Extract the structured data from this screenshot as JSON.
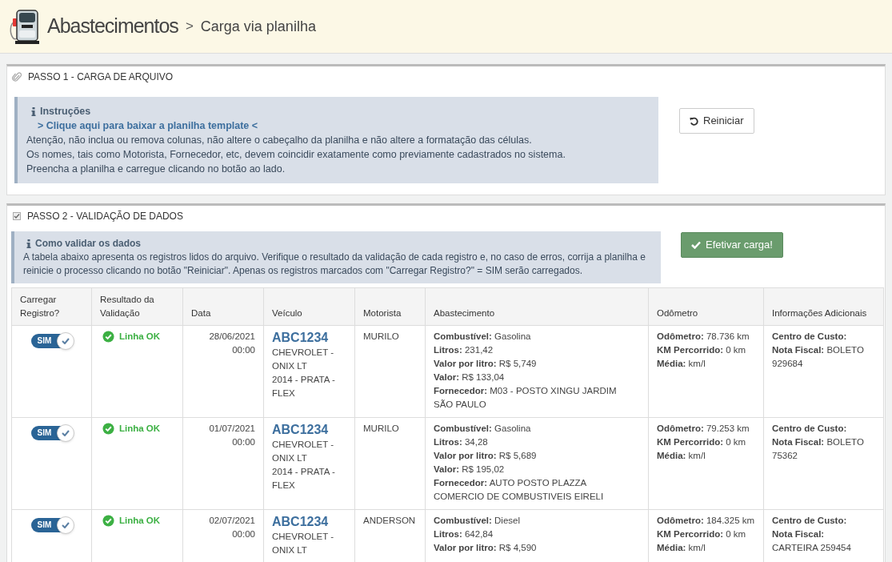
{
  "header": {
    "title": "Abastecimentos",
    "separator": ">",
    "subtitle": "Carga via planilha"
  },
  "step1": {
    "title": "PASSO 1 - CARGA DE ARQUIVO",
    "info_title": "Instruções",
    "download_link": "> Clique aqui para baixar a planilha template <",
    "lines": [
      "Atenção, não inclua ou remova colunas, não altere o cabeçalho da planilha e não altere a formatação das células.",
      "Os nomes, tais como Motorista, Fornecedor, etc, devem coincidir exatamente como previamente cadastrados no sistema.",
      "Preencha a planilha e carregue clicando no botão ao lado."
    ],
    "button": "Reiniciar"
  },
  "step2": {
    "title": "PASSO 2 - VALIDAÇÃO DE DADOS",
    "info_title": "Como validar os dados",
    "text": "A tabela abaixo apresenta os registros lidos do arquivo. Verifique o resultado da validação de cada registro e, no caso de erros, corrija a planilha e reinicie o processo clicando no botão \"Reiniciar\". Apenas os registros marcados com \"Carregar Registro?\" = SIM serão carregados.",
    "button": "Efetivar carga!"
  },
  "table": {
    "columns": [
      "Carregar Registro?",
      "Resultado da Validação",
      "Data",
      "Veículo",
      "Motorista",
      "Abastecimento",
      "Odômetro",
      "Informações Adicionais"
    ],
    "rows": [
      {
        "load": true,
        "toggle_label": "SIM",
        "ok": true,
        "result": "Linha OK",
        "date": "28/06/2021 00:00",
        "plate": "ABC1234",
        "vehicle": "CHEVROLET - ONIX LT",
        "vehicle_details": "2014 - PRATA - FLEX",
        "driver": "MURILO",
        "fueling": [
          "**Combustível:** Gasolina",
          "**Litros:** 231,42",
          "**Valor por litro:**  R$ 5,749",
          "**Valor:**  R$ 133,04",
          "**Fornecedor:** M03 - POSTO XINGU JARDIM SÃO PAULO"
        ],
        "odometer": [
          "**Odômetro:** 78.736 km",
          "**KM Percorrido:** 0 km",
          "**Média:**  km/l"
        ],
        "info": [
          "**Centro de Custo:**",
          "**Nota Fiscal:** BOLETO 929684"
        ]
      },
      {
        "load": true,
        "toggle_label": "SIM",
        "ok": true,
        "result": "Linha OK",
        "date": "01/07/2021 00:00",
        "plate": "ABC1234",
        "vehicle": "CHEVROLET - ONIX LT",
        "vehicle_details": "2014 - PRATA - FLEX",
        "driver": "MURILO",
        "fueling": [
          "**Combustível:** Gasolina",
          "**Litros:** 34,28",
          "**Valor por litro:**  R$ 5,689",
          "**Valor:**  R$ 195,02",
          "**Fornecedor:** AUTO POSTO PLAZZA COMERCIO DE COMBUSTIVEIS EIRELI"
        ],
        "odometer": [
          "**Odômetro:** 79.253 km",
          "**KM Percorrido:** 0 km",
          "**Média:**  km/l"
        ],
        "info": [
          "**Centro de Custo:**",
          "**Nota Fiscal:** BOLETO 75362"
        ]
      },
      {
        "load": true,
        "toggle_label": "SIM",
        "ok": true,
        "result": "Linha OK",
        "date": "02/07/2021 00:00",
        "plate": "ABC1234",
        "vehicle": "CHEVROLET - ONIX LT",
        "driver": "ANDERSON",
        "fueling": [
          "**Combustível:** Diesel",
          "**Litros:** 642,84",
          "**Valor por litro:**  R$ 4,590"
        ],
        "odometer": [
          "**Odômetro:** 184.325 km",
          "**KM Percorrido:** 0 km",
          "**Média:**  km/l"
        ],
        "info": [
          "**Centro de Custo:**",
          "**Nota Fiscal:** CARTEIRA 259454"
        ]
      }
    ]
  }
}
